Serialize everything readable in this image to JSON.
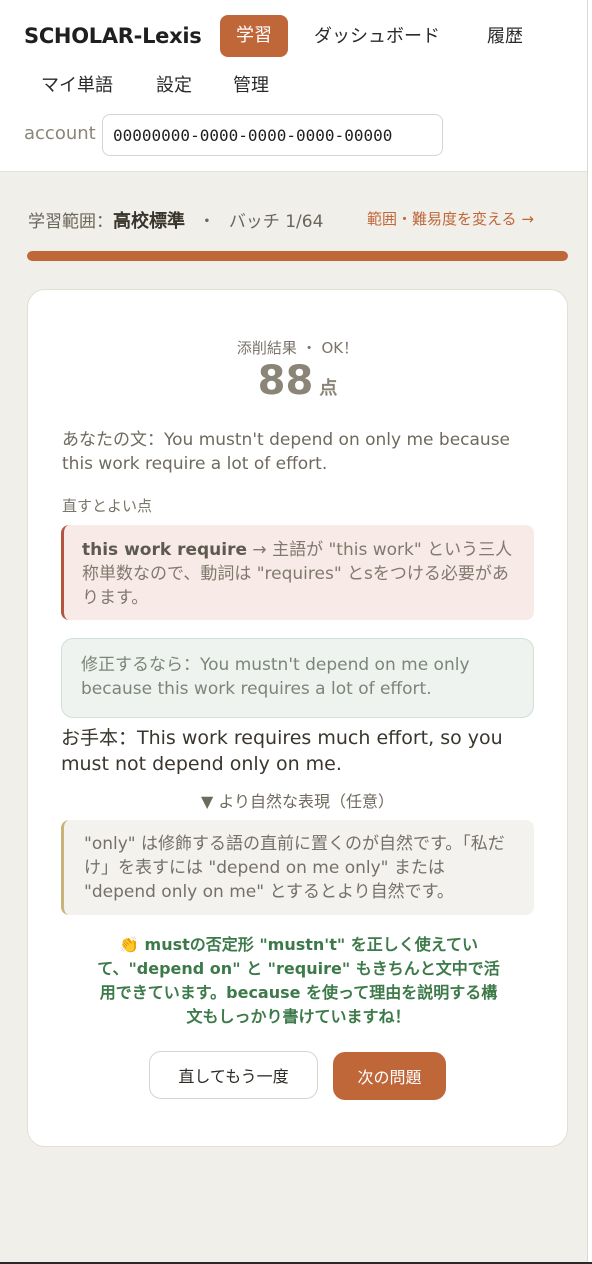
{
  "header": {
    "brand": "SCHOLAR-Lexis",
    "nav": [
      "学習",
      "ダッシュボード",
      "履歴",
      "マイ単語",
      "設定",
      "管理"
    ],
    "active_nav": "学習",
    "account_label": "account",
    "account_value": "00000000-0000-0000-0000-00000"
  },
  "scope": {
    "prefix": "学習範囲：",
    "level": "高校標準",
    "separator": "・",
    "batch": "バッチ 1/64",
    "change_link": "範囲・難易度を変える →"
  },
  "progress": {
    "fraction": 1.0
  },
  "result": {
    "label": "添削結果 ・ OK！",
    "score": "88",
    "unit": "点",
    "your_sentence": "あなたの文：You mustn't depend on only me because this work require a lot of effort.",
    "fix_title": "直すとよい点",
    "error_phrase": "this work require",
    "error_detail": " → 主語が \"this work\" という三人称単数なので、動詞は \"requires\" とsをつける必要があります。",
    "correction": "修正するなら：You mustn't depend on me only because this work requires a lot of effort.",
    "model": "お手本：This work requires much effort, so you must not depend only on me.",
    "natural_toggle": "▼ より自然な表現（任意）",
    "natural_note": "\"only\" は修飾する語の直前に置くのが自然です。「私だけ」を表すには \"depend on me only\" または \"depend only on me\" とするとより自然です。",
    "praise": "👏 mustの否定形 \"mustn't\" を正しく使えていて、\"depend on\" と \"require\" もきちんと文中で活用できています。because を使って理由を説明する構文もしっかり書けていますね！"
  },
  "actions": {
    "retry": "直してもう一度",
    "next": "次の問題"
  },
  "colors": {
    "accent": "#c0673a",
    "praise": "#3d7a4a",
    "error_border": "#b4563f"
  }
}
